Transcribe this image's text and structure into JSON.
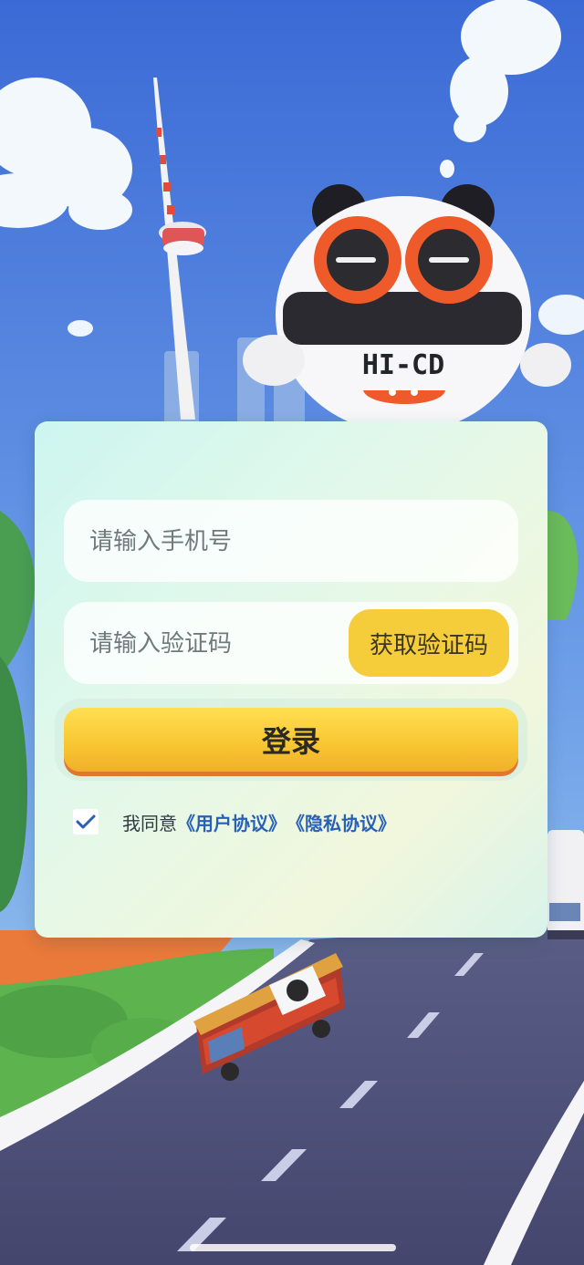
{
  "mascot": {
    "badge": "HI-CD"
  },
  "login": {
    "phone_placeholder": "请输入手机号",
    "code_placeholder": "请输入验证码",
    "get_code_label": "获取验证码",
    "submit_label": "登录"
  },
  "agreement": {
    "checked": true,
    "prefix": "我同意",
    "user_agreement": "《用户协议》",
    "privacy_agreement": "《隐私协议》"
  },
  "colors": {
    "accent_yellow": "#f5cd3b",
    "link_blue": "#2760b5",
    "sky_top": "#3f6fd8",
    "mascot_orange": "#ee5a2a"
  }
}
